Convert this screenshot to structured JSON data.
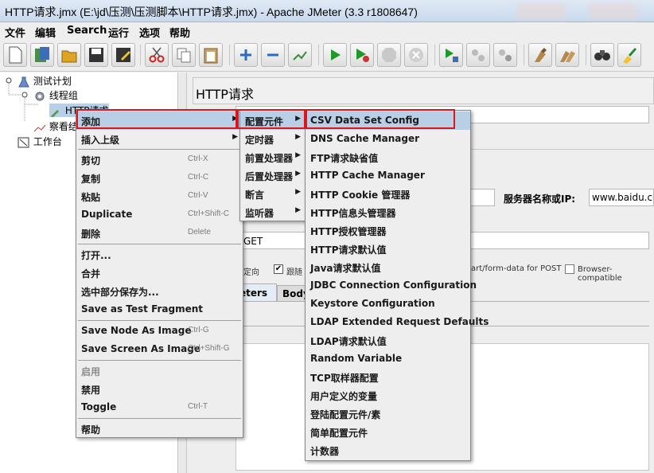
{
  "window": {
    "title": "HTTP请求.jmx (E:\\jd\\压测\\压测脚本\\HTTP请求.jmx) - Apache JMeter (3.3 r1808647)"
  },
  "menubar": [
    "文件",
    "编辑",
    "Search",
    "运行",
    "选项",
    "帮助"
  ],
  "toolbar": {
    "buttons": [
      "new-icon",
      "templates-icon",
      "open-icon",
      "save-icon",
      "save-as-icon",
      "cut-icon",
      "copy-icon",
      "paste-icon",
      "expand-icon",
      "collapse-icon",
      "toggle-icon",
      "start-icon",
      "start-no-pause-icon",
      "stop-icon",
      "shutdown-icon",
      "remote-start-icon",
      "remote-stop-icon",
      "remote-shutdown-icon",
      "clear-icon",
      "clear-all-icon",
      "search-icon",
      "reset-search-icon"
    ]
  },
  "tree": {
    "items": [
      "测试计划",
      "线程组",
      "HTTP请求",
      "察看结",
      "工作台"
    ]
  },
  "right_panel": {
    "title": "HTTP请求",
    "server_label": "服务器名称或IP:",
    "server_value": "www.baidu.co",
    "method_value": "GET",
    "redirect_label": "定向",
    "follow_label": "跟随",
    "multipart_label": "art/form-data for POST",
    "browser_compat_label": "Browser-compatible",
    "tabs": [
      "eters",
      "Body"
    ]
  },
  "context_menu": {
    "items": [
      {
        "label": "添加",
        "shortcut": "",
        "arrow": true,
        "selected": true
      },
      {
        "label": "插入上级",
        "shortcut": "",
        "arrow": true
      },
      {
        "label": "剪切",
        "shortcut": "Ctrl-X"
      },
      {
        "label": "复制",
        "shortcut": "Ctrl-C"
      },
      {
        "label": "粘贴",
        "shortcut": "Ctrl-V"
      },
      {
        "label": "Duplicate",
        "shortcut": "Ctrl+Shift-C"
      },
      {
        "label": "删除",
        "shortcut": "Delete"
      },
      {
        "label": "打开...",
        "shortcut": ""
      },
      {
        "label": "合并",
        "shortcut": ""
      },
      {
        "label": "选中部分保存为...",
        "shortcut": ""
      },
      {
        "label": "Save as Test Fragment",
        "shortcut": ""
      },
      {
        "label": "Save Node As Image",
        "shortcut": "Ctrl-G"
      },
      {
        "label": "Save Screen As Image",
        "shortcut": "Ctrl+Shift-G"
      },
      {
        "label": "启用",
        "shortcut": "",
        "disabled": true
      },
      {
        "label": "禁用",
        "shortcut": ""
      },
      {
        "label": "Toggle",
        "shortcut": "Ctrl-T"
      },
      {
        "label": "帮助",
        "shortcut": ""
      }
    ]
  },
  "add_submenu": {
    "items": [
      {
        "label": "配置元件",
        "selected": true
      },
      {
        "label": "定时器"
      },
      {
        "label": "前置处理器"
      },
      {
        "label": "后置处理器"
      },
      {
        "label": "断言"
      },
      {
        "label": "监听器"
      }
    ]
  },
  "config_submenu": {
    "items": [
      "CSV Data Set Config",
      "DNS Cache Manager",
      "FTP请求缺省值",
      "HTTP Cache Manager",
      "HTTP Cookie 管理器",
      "HTTP信息头管理器",
      "HTTP授权管理器",
      "HTTP请求默认值",
      "Java请求默认值",
      "JDBC Connection Configuration",
      "Keystore Configuration",
      "LDAP Extended Request Defaults",
      "LDAP请求默认值",
      "Random Variable",
      "TCP取样器配置",
      "用户定义的变量",
      "登陆配置元件/素",
      "简单配置元件",
      "计数器"
    ]
  },
  "colors": {
    "highlight": "#b8cfe5",
    "red_annotation": "#e0151b"
  }
}
